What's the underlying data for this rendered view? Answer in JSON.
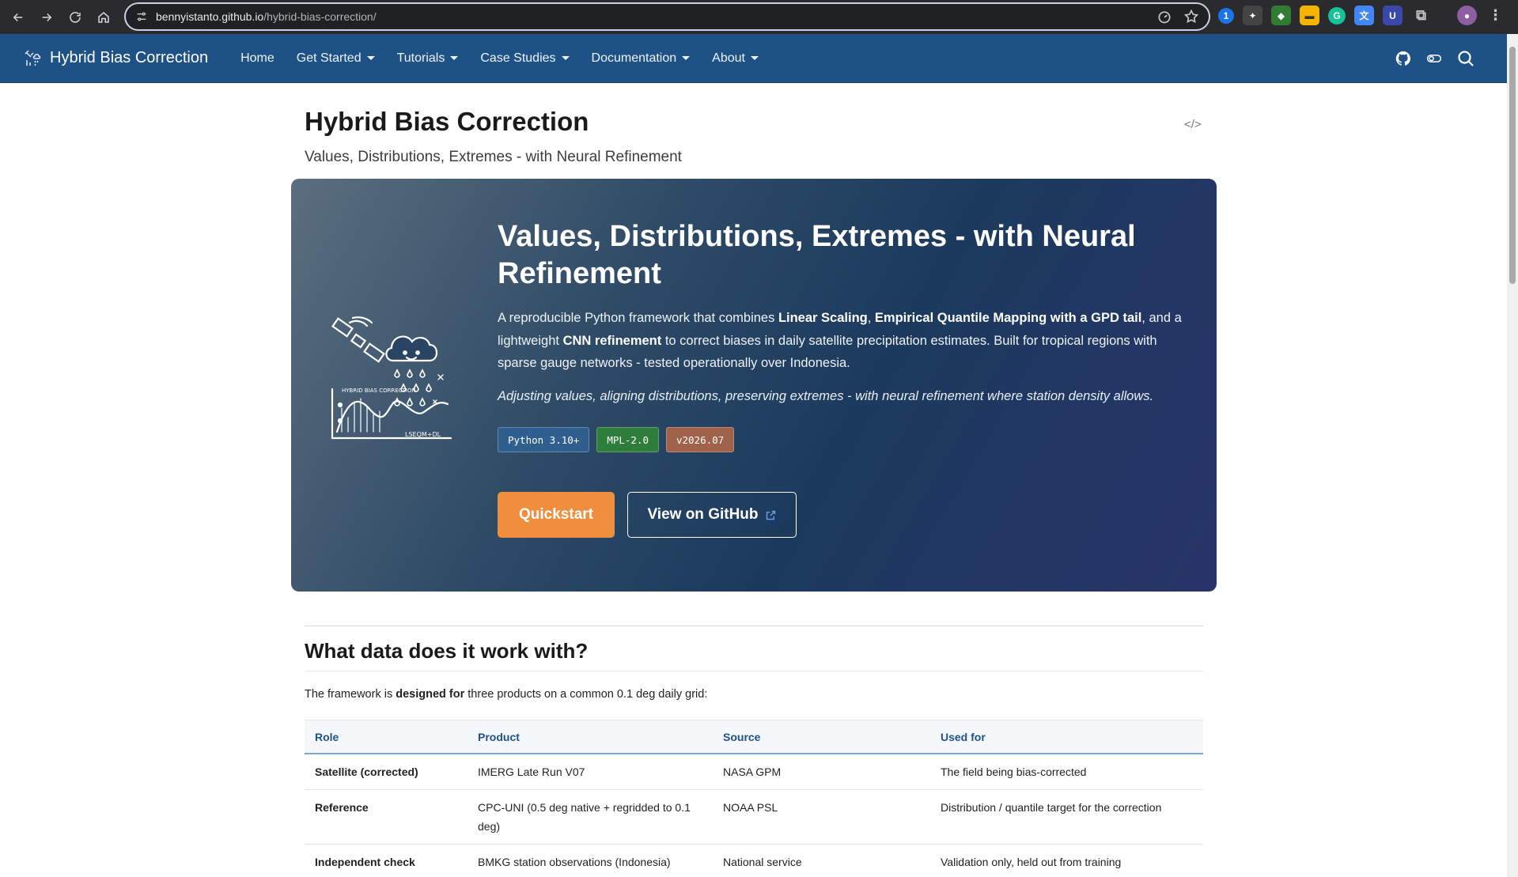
{
  "browser": {
    "url_host": "bennyistanto.github.io",
    "url_path": "/hybrid-bias-correction/"
  },
  "nav": {
    "brand": "Hybrid Bias Correction",
    "items": [
      {
        "label": "Home"
      },
      {
        "label": "Get Started"
      },
      {
        "label": "Tutorials"
      },
      {
        "label": "Case Studies"
      },
      {
        "label": "Documentation"
      },
      {
        "label": "About"
      }
    ]
  },
  "page": {
    "title": "Hybrid Bias Correction",
    "subtitle": "Values, Distributions, Extremes - with Neural Refinement"
  },
  "hero": {
    "heading": "Values, Distributions, Extremes - with Neural Refinement",
    "p_parts": {
      "t1": "A reproducible Python framework that combines ",
      "b1": "Linear Scaling",
      "t2": ", ",
      "b2": "Empirical Quantile Mapping with a GPD tail",
      "t3": ", and a lightweight ",
      "b3": "CNN refinement",
      "t4": " to correct biases in daily satellite precipitation estimates. Built for tropical regions with sparse gauge networks - tested operationally over Indonesia."
    },
    "italic": "Adjusting values, aligning distributions, preserving extremes - with neural refinement where station density allows.",
    "badges": [
      {
        "label": "Python 3.10+",
        "color": "#2f5f8f"
      },
      {
        "label": "MPL-2.0",
        "color": "#2e7d3a"
      },
      {
        "label": "v2026.07",
        "color": "#a0624a"
      }
    ],
    "illustration_labels": {
      "brand": "HYBRID BIAS CORRECTION",
      "formula": "LSEQM+DL"
    },
    "quickstart_label": "Quickstart",
    "github_label": "View on GitHub"
  },
  "section": {
    "heading": "What data does it work with?",
    "intro_t1": "The framework is ",
    "intro_b": "designed for",
    "intro_t2": " three products on a common 0.1 deg daily grid:"
  },
  "table": {
    "headers": [
      "Role",
      "Product",
      "Source",
      "Used for"
    ],
    "rows": [
      [
        "Satellite (corrected)",
        "IMERG Late Run V07",
        "NASA GPM",
        "The field being bias-corrected"
      ],
      [
        "Reference",
        "CPC-UNI (0.5 deg native + regridded to 0.1 deg)",
        "NOAA PSL",
        "Distribution / quantile target for the correction"
      ],
      [
        "Independent check",
        "BMKG station observations (Indonesia)",
        "National service",
        "Validation only, held out from training"
      ]
    ]
  },
  "colors": {
    "navbar": "#1e5286",
    "quickstart": "#ef8f3e"
  }
}
